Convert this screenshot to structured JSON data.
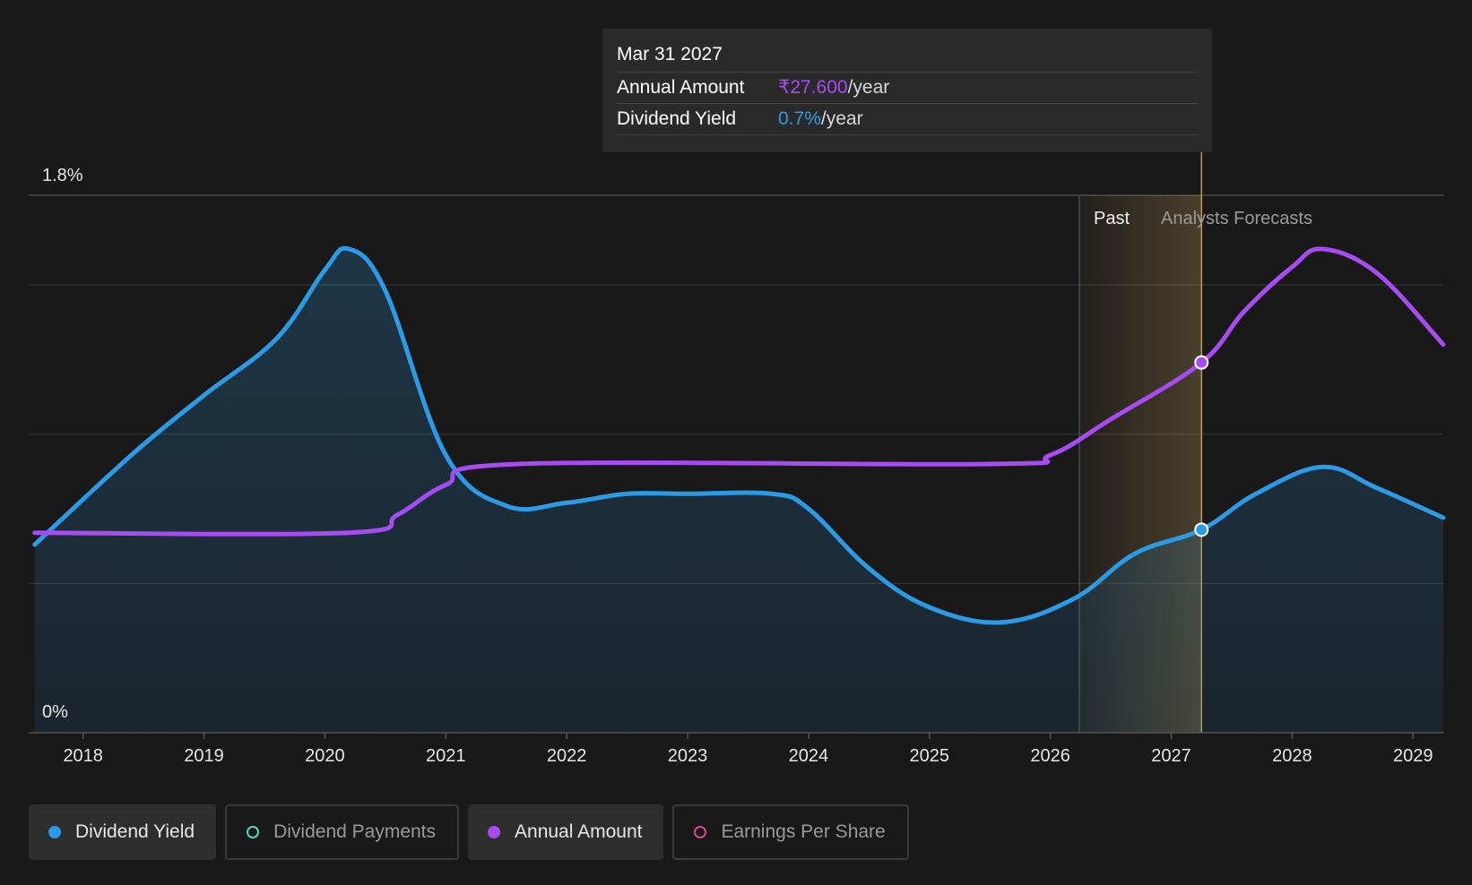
{
  "tooltip": {
    "date": "Mar 31 2027",
    "rows": [
      {
        "label": "Annual Amount",
        "value": "₹27.600",
        "unit": "/year"
      },
      {
        "label": "Dividend Yield",
        "value": "0.7%",
        "unit": "/year"
      }
    ]
  },
  "legend": [
    {
      "label": "Dividend Yield",
      "active": true,
      "color": "#2d9ae5",
      "marker": "filled"
    },
    {
      "label": "Dividend Payments",
      "active": false,
      "color": "#5fd4c0",
      "marker": "hollow"
    },
    {
      "label": "Annual Amount",
      "active": true,
      "color": "#a64cf0",
      "marker": "filled"
    },
    {
      "label": "Earnings Per Share",
      "active": false,
      "color": "#d64a8a",
      "marker": "hollow"
    }
  ],
  "colors": {
    "background": "#191919",
    "dividend_yield": "#2d9ae5",
    "annual_amount": "#a64cf0",
    "forecast_band": "#c9a15a",
    "grid": "#3a3a3a"
  },
  "chart_data": {
    "type": "line",
    "y_axis": {
      "min_label": "0%",
      "max_label": "1.8%",
      "range": [
        0,
        1.8
      ]
    },
    "x_axis": {
      "tick_labels": [
        "2018",
        "2019",
        "2020",
        "2021",
        "2022",
        "2023",
        "2024",
        "2025",
        "2026",
        "2027",
        "2028",
        "2029"
      ],
      "range": [
        2017.55,
        2029.25
      ]
    },
    "grid": true,
    "past_label": "Past",
    "forecast_label": "Analysts Forecasts",
    "forecast_start": 2026.24,
    "hover_x": 2027.25,
    "series": [
      {
        "name": "Dividend Yield",
        "area": true,
        "points": [
          [
            2017.6,
            0.63
          ],
          [
            2018.4,
            0.93
          ],
          [
            2019.0,
            1.13
          ],
          [
            2019.6,
            1.32
          ],
          [
            2020.0,
            1.55
          ],
          [
            2020.2,
            1.62
          ],
          [
            2020.5,
            1.48
          ],
          [
            2021.0,
            0.93
          ],
          [
            2021.5,
            0.76
          ],
          [
            2022.0,
            0.77
          ],
          [
            2022.5,
            0.8
          ],
          [
            2023.0,
            0.8
          ],
          [
            2023.7,
            0.8
          ],
          [
            2024.0,
            0.75
          ],
          [
            2024.5,
            0.55
          ],
          [
            2025.0,
            0.42
          ],
          [
            2025.6,
            0.37
          ],
          [
            2026.2,
            0.45
          ],
          [
            2026.7,
            0.6
          ],
          [
            2027.25,
            0.68
          ],
          [
            2027.7,
            0.8
          ],
          [
            2028.25,
            0.89
          ],
          [
            2028.7,
            0.82
          ],
          [
            2029.25,
            0.72
          ]
        ]
      },
      {
        "name": "Annual Amount",
        "area": false,
        "points": [
          [
            2017.6,
            0.67
          ],
          [
            2020.2,
            0.67
          ],
          [
            2020.6,
            0.73
          ],
          [
            2021.0,
            0.83
          ],
          [
            2021.6,
            0.9
          ],
          [
            2025.5,
            0.9
          ],
          [
            2026.0,
            0.93
          ],
          [
            2026.5,
            1.05
          ],
          [
            2027.25,
            1.24
          ],
          [
            2027.6,
            1.41
          ],
          [
            2028.0,
            1.56
          ],
          [
            2028.25,
            1.62
          ],
          [
            2028.7,
            1.54
          ],
          [
            2029.25,
            1.3
          ]
        ]
      }
    ]
  }
}
